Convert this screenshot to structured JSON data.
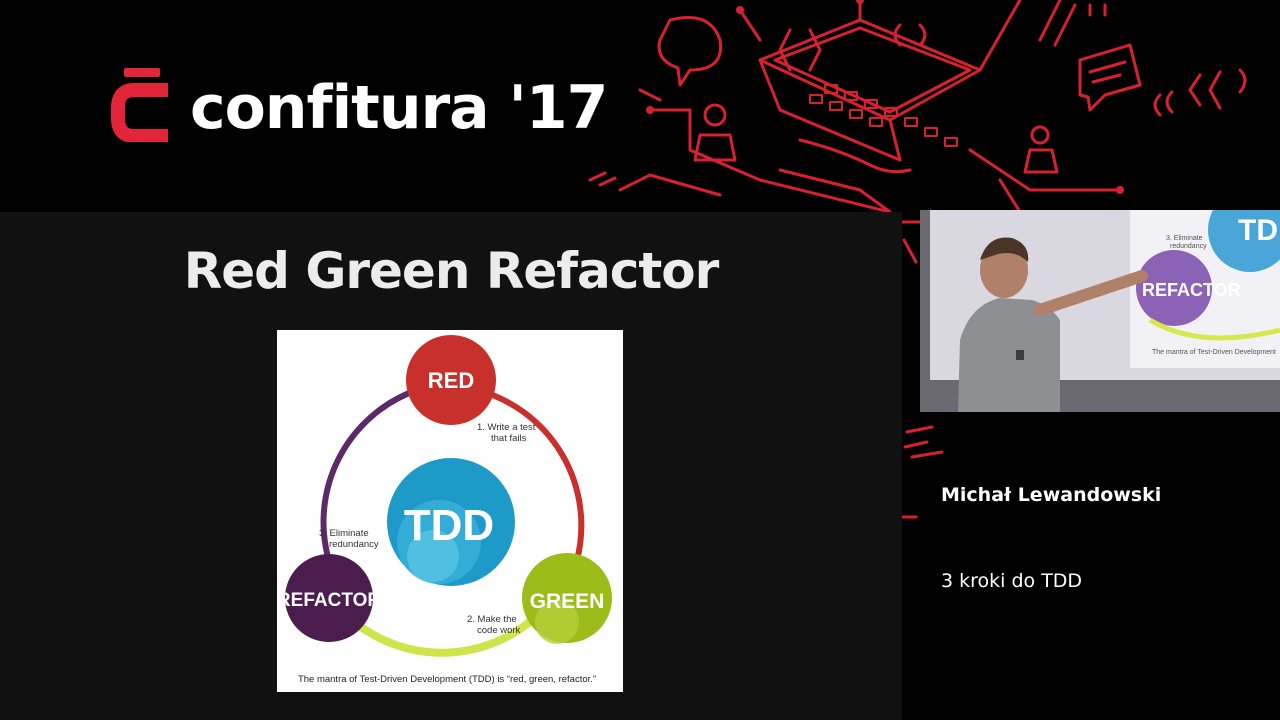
{
  "brand": {
    "logo_text": "confitura '17",
    "accent_color": "#e3253a",
    "logo_icon": "confitura-c-icon"
  },
  "slide": {
    "title": "Red Green Refactor",
    "diagram": {
      "center": "TDD",
      "red": "RED",
      "green": "GREEN",
      "refactor": "REFACTOR",
      "step1_line1": "1. Write a test",
      "step1_line2": "that fails",
      "step2_line1": "2. Make the",
      "step2_line2": "code work",
      "step3_line1": "3. Eliminate",
      "step3_line2": "redundancy",
      "caption": "The mantra of Test-Driven Development (TDD) is “red, green, refactor.”",
      "colors": {
        "red": "#c8302c",
        "green": "#9cbc1a",
        "refactor": "#4a1d4e",
        "tdd": "#1d9ac8",
        "ring_purple": "#5a2a6b",
        "ring_lime": "#cfe34a"
      }
    }
  },
  "video": {
    "screen_step": "3. Eliminate",
    "screen_step2": "redundancy",
    "screen_refactor": "REFACTOR",
    "screen_tdd": "TDD",
    "screen_caption": "The mantra of Test-Driven Development"
  },
  "speaker": {
    "name": "Michał Lewandowski"
  },
  "talk": {
    "title": "3 kroki do TDD"
  }
}
